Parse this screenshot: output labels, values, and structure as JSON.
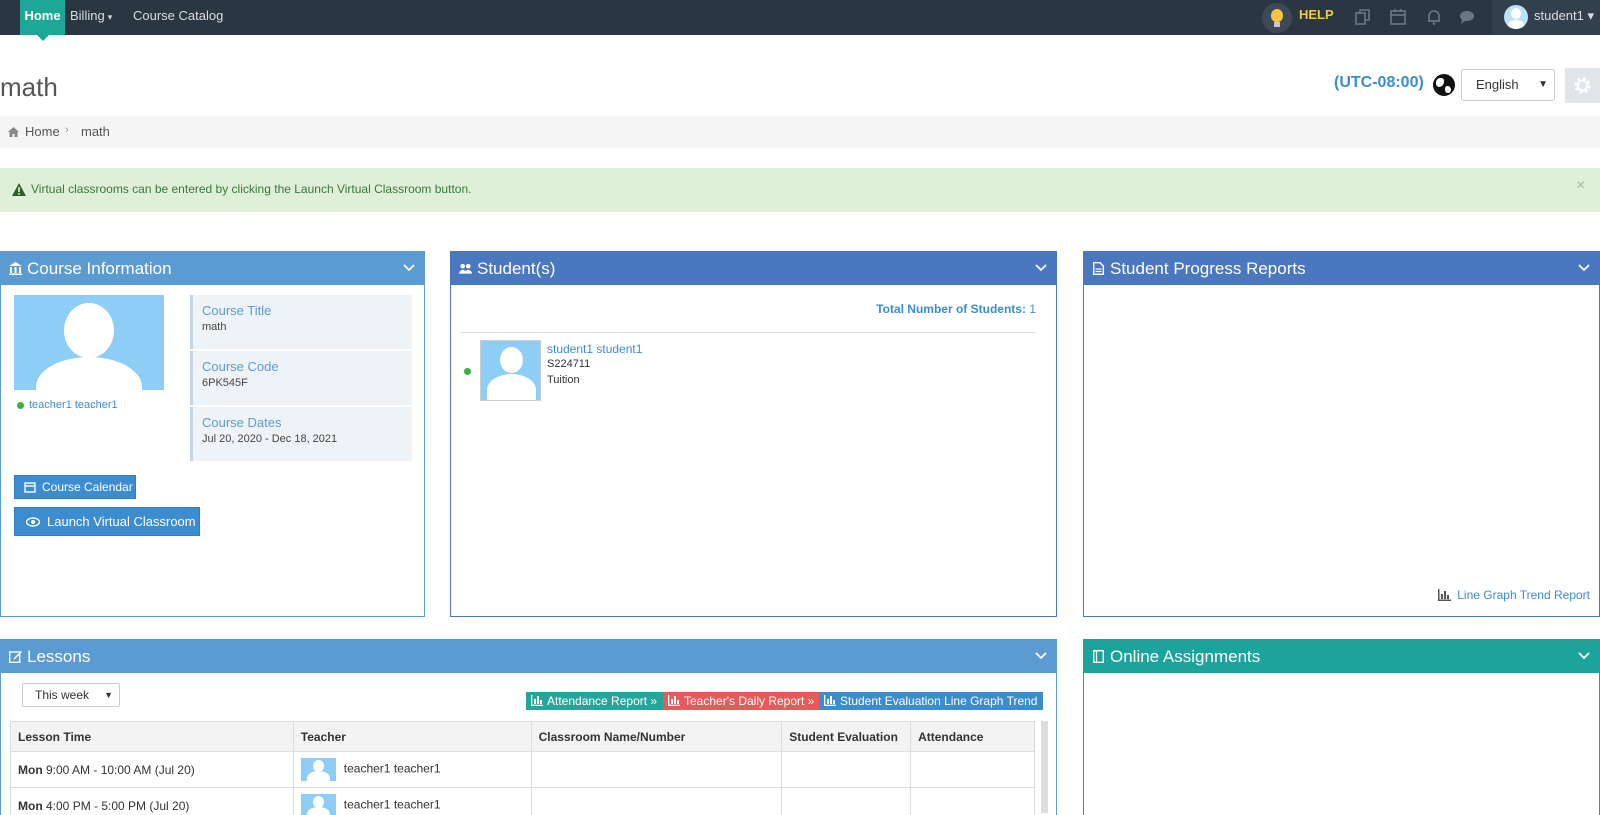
{
  "nav": {
    "home": "Home",
    "billing": "Billing",
    "catalog": "Course Catalog",
    "help": "HELP",
    "user": "student1"
  },
  "page": {
    "title": "math",
    "timezone": "(UTC-08:00)",
    "language": "English"
  },
  "breadcrumb": {
    "home": "Home",
    "current": "math"
  },
  "alert": {
    "message": "Virtual classrooms can be entered by clicking the Launch Virtual Classroom button.",
    "close": "×"
  },
  "course_info": {
    "header": "Course Information",
    "teacher": "teacher1 teacher1",
    "title_label": "Course Title",
    "title_value": "math",
    "code_label": "Course Code",
    "code_value": "6PK545F",
    "dates_label": "Course Dates",
    "dates_value": "Jul 20, 2020 - Dec 18, 2021",
    "calendar_button": "Course Calendar",
    "launch_button": "Launch Virtual Classroom"
  },
  "students": {
    "header": "Student(s)",
    "total_label": "Total Number of Students:",
    "total_value": "1",
    "list": [
      {
        "name": "student1 student1",
        "id": "S224711",
        "type": "Tuition"
      }
    ]
  },
  "progress": {
    "header": "Student Progress Reports",
    "trend_link": "Line Graph Trend Report"
  },
  "lessons": {
    "header": "Lessons",
    "period": "This week",
    "attendance_btn": "Attendance Report »",
    "daily_btn": "Teacher's Daily Report »",
    "eval_btn": "Student Evaluation Line Graph Trend",
    "columns": [
      "Lesson Time",
      "Teacher",
      "Classroom Name/Number",
      "Student Evaluation",
      "Attendance"
    ],
    "rows": [
      {
        "day": "Mon",
        "time": "9:00 AM - 10:00 AM (Jul 20)",
        "teacher": "teacher1 teacher1"
      },
      {
        "day": "Mon",
        "time": "4:00 PM - 5:00 PM (Jul 20)",
        "teacher": "teacher1 teacher1"
      }
    ]
  },
  "assignments": {
    "header": "Online Assignments"
  },
  "colors": {
    "nav_bg": "#2b3643",
    "nav_active": "#1da797",
    "portlet_blue": "#5b9bd1",
    "portlet_dark_blue": "#4b77be",
    "portlet_teal": "#1ba39c",
    "alert_bg": "#dff0d8"
  },
  "icons": [
    "bulb-icon",
    "copy-icon",
    "calendar-icon",
    "bell-icon",
    "chat-icon",
    "globe-icon",
    "gear-icon",
    "home-icon",
    "warning-icon",
    "bank-icon",
    "users-icon",
    "file-icon",
    "edit-icon",
    "bar-chart-icon",
    "eye-icon",
    "book-icon",
    "chevron-down-icon"
  ]
}
